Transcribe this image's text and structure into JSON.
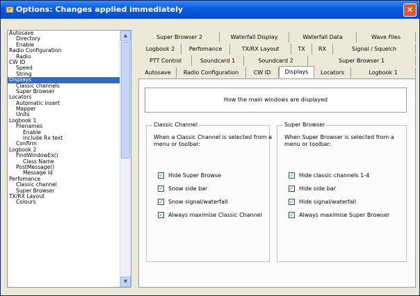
{
  "window": {
    "title": "Options: Changes applied immediately",
    "close_symbol": "✕",
    "title_icon": "app-icon",
    "accent_color": "#0a5fe0"
  },
  "tree": {
    "items": [
      {
        "label": "Autosave",
        "level": 0
      },
      {
        "label": "Directory",
        "level": 1
      },
      {
        "label": "Enable",
        "level": 1
      },
      {
        "label": "Radio Configuration",
        "level": 0
      },
      {
        "label": "Radio",
        "level": 1
      },
      {
        "label": "CW ID",
        "level": 0
      },
      {
        "label": "Speed",
        "level": 1
      },
      {
        "label": "String",
        "level": 1
      },
      {
        "label": "Displays",
        "level": 0,
        "selected": true
      },
      {
        "label": "Classic channels",
        "level": 1
      },
      {
        "label": "Super Browser",
        "level": 1
      },
      {
        "label": "Locators",
        "level": 0
      },
      {
        "label": "Automatic insert",
        "level": 1
      },
      {
        "label": "Mapper",
        "level": 1
      },
      {
        "label": "Units",
        "level": 1
      },
      {
        "label": "Logbook 1",
        "level": 0
      },
      {
        "label": "Filenames",
        "level": 1
      },
      {
        "label": "Enable",
        "level": 2
      },
      {
        "label": "Include Rx text",
        "level": 2
      },
      {
        "label": "Confirm",
        "level": 1
      },
      {
        "label": "Logbook 2",
        "level": 0
      },
      {
        "label": "FindWindowEx()",
        "level": 1
      },
      {
        "label": "Class Name",
        "level": 2
      },
      {
        "label": "PostMessage()",
        "level": 1
      },
      {
        "label": "Message Id",
        "level": 2
      },
      {
        "label": "Perfomance",
        "level": 0
      },
      {
        "label": "Classic channel",
        "level": 1
      },
      {
        "label": "Super Browser",
        "level": 1
      },
      {
        "label": "TX/RX Layout",
        "level": 0
      },
      {
        "label": "Colours",
        "level": 1
      }
    ]
  },
  "tabs": {
    "row1": [
      "Super Browser 2",
      "Waterfall Display",
      "Waterfall Data",
      "Wave Files"
    ],
    "row2": [
      "Logbook 2",
      "Perfomance",
      "TX/RX Layout",
      "TX",
      "RX",
      "Signal / Squelch"
    ],
    "row3": [
      "PTT Control",
      "Soundcard 1",
      "Soundcard 2",
      "Super Browser 1"
    ],
    "row4": [
      "Autosave",
      "Radio Configuration",
      "CW ID",
      "Displays",
      "Locators",
      "Logbook 1"
    ],
    "active": "Displays"
  },
  "panel": {
    "description": "How the main windows are displayed",
    "classic": {
      "title": "Classic Channel",
      "intro": "When a Classic Channel is selected from a menu or toolbar:",
      "options": [
        {
          "label": "Hide Super Browse",
          "checked": true
        },
        {
          "label": "Snow side bar",
          "checked": true
        },
        {
          "label": "Snow signal/waterfall",
          "checked": true
        },
        {
          "label": "Always maximise Classic Channel",
          "checked": true
        }
      ]
    },
    "browser": {
      "title": "Super Browser",
      "intro": "When Super Browser is selected from a menu or toolbar:",
      "options": [
        {
          "label": "Hide classic channels 1-4",
          "checked": true
        },
        {
          "label": "Hide side bar",
          "checked": true
        },
        {
          "label": "Hide signal/waterfall",
          "checked": true
        },
        {
          "label": "Always maximise Super Browser",
          "checked": true
        }
      ]
    }
  },
  "check_symbol": "✓"
}
